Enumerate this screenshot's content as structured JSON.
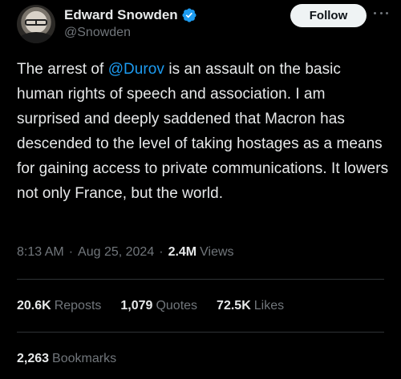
{
  "author": {
    "display_name": "Edward Snowden",
    "handle": "@Snowden",
    "verified_icon": "verified-badge-icon",
    "verified_color": "#1d9bf0"
  },
  "actions": {
    "follow_label": "Follow",
    "more_icon": "more-options-icon"
  },
  "tweet": {
    "text_before_mention": "The arrest of ",
    "mention": "@Durov",
    "text_after_mention": " is an assault on the basic human rights of speech and association. I am surprised and deeply saddened that Macron has descended to the level of taking hostages as a means for gaining access to private communications. It lowers not only France, but the world."
  },
  "meta": {
    "time": "8:13 AM",
    "separator": "·",
    "date": "Aug 25, 2024",
    "views_count": "2.4M",
    "views_label": "Views"
  },
  "stats": {
    "reposts_count": "20.6K",
    "reposts_label": "Reposts",
    "quotes_count": "1,079",
    "quotes_label": "Quotes",
    "likes_count": "72.5K",
    "likes_label": "Likes",
    "bookmarks_count": "2,263",
    "bookmarks_label": "Bookmarks"
  },
  "colors": {
    "background": "#000000",
    "text": "#e7e9ea",
    "secondary_text": "#71767b",
    "link": "#1d9bf0",
    "divider": "#2f3336"
  }
}
